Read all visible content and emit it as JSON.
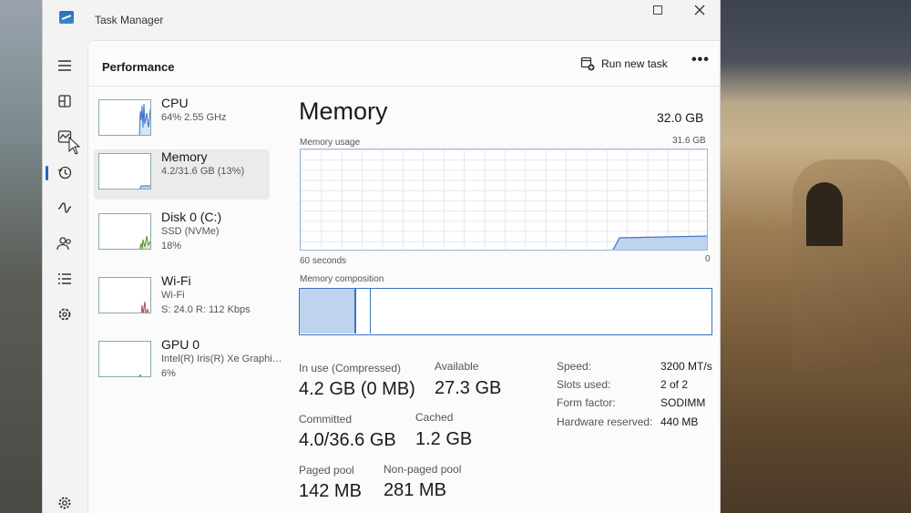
{
  "window": {
    "title": "Task Manager"
  },
  "header": {
    "title": "Performance",
    "run_new_task": "Run new task",
    "more": "•••"
  },
  "nav": [
    {
      "name": "hamburger-menu-icon"
    },
    {
      "name": "processes-icon"
    },
    {
      "name": "performance-icon",
      "active": true
    },
    {
      "name": "app-history-icon"
    },
    {
      "name": "startup-apps-icon"
    },
    {
      "name": "users-icon"
    },
    {
      "name": "details-icon"
    },
    {
      "name": "services-icon"
    },
    {
      "name": "settings-icon"
    }
  ],
  "devices": [
    {
      "name": "CPU",
      "line1": "64%  2.55 GHz",
      "line2": ""
    },
    {
      "name": "Memory",
      "line1": "4.2/31.6 GB (13%)",
      "line2": "",
      "selected": true
    },
    {
      "name": "Disk 0 (C:)",
      "line1": "SSD (NVMe)",
      "line2": "18%"
    },
    {
      "name": "Wi-Fi",
      "line1": "Wi-Fi",
      "line2": "S: 24.0  R: 112 Kbps"
    },
    {
      "name": "GPU 0",
      "line1": "Intel(R) Iris(R) Xe Graphi…",
      "line2": "6%"
    }
  ],
  "memory": {
    "title": "Memory",
    "total": "32.0 GB",
    "usage_label": "Memory usage",
    "usage_max": "31.6 GB",
    "time_left": "60 seconds",
    "time_right": "0",
    "composition_label": "Memory composition",
    "stats": {
      "in_use_label": "In use (Compressed)",
      "in_use_value": "4.2 GB (0 MB)",
      "available_label": "Available",
      "available_value": "27.3 GB",
      "committed_label": "Committed",
      "committed_value": "4.0/36.6 GB",
      "cached_label": "Cached",
      "cached_value": "1.2 GB",
      "paged_label": "Paged pool",
      "paged_value": "142 MB",
      "nonpaged_label": "Non-paged pool",
      "nonpaged_value": "281 MB"
    },
    "details": {
      "speed_label": "Speed:",
      "speed_value": "3200 MT/s",
      "slots_label": "Slots used:",
      "slots_value": "2 of 2",
      "form_label": "Form factor:",
      "form_value": "SODIMM",
      "reserved_label": "Hardware reserved:",
      "reserved_value": "440 MB"
    }
  },
  "colors": {
    "accent": "#2563c7",
    "memory_fill": "#bdd3ee",
    "memory_line": "#3d74c2"
  }
}
